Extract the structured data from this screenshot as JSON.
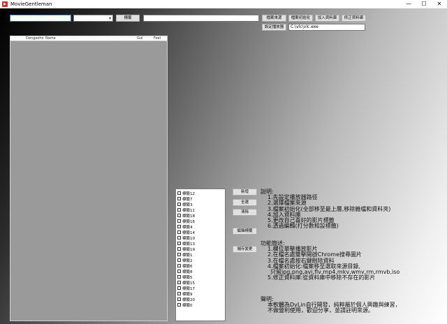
{
  "window": {
    "title": "MovieGentleman",
    "icon": "film-clapper-icon",
    "minimize": "—",
    "maximize": "☐",
    "close": "✕"
  },
  "toolbar": {
    "search_value": "",
    "category_value": "",
    "tag_button": "標籤",
    "source_path_value": "",
    "source_button": "檔案來源",
    "init_button": "檔案初始化",
    "add_db_button": "加入資料庫",
    "edit_db_button": "修正資料庫",
    "set_player_button": "設定播放器",
    "player_path_value": "C:\\vlc\\vlc.exe"
  },
  "listview": {
    "columns": [
      "Dengaoho",
      "Name",
      "Gul",
      "Feel"
    ]
  },
  "tags": [
    "標籤12",
    "標籤7",
    "標籤3",
    "標籤11",
    "標籤18",
    "標籤16",
    "標籤4",
    "標籤14",
    "標籤10",
    "標籤13",
    "標籤19",
    "標籤1",
    "標籤2",
    "標籤6",
    "標籤8",
    "標籤5",
    "標籤15",
    "標籤17",
    "標籤9",
    "標籤20",
    "標籤0"
  ],
  "tag_actions": {
    "new_button": "新增",
    "save_button": "全選",
    "delete_button": "清除",
    "edit_tag_button": "編輯標籤",
    "save_change_button": "儲存變更"
  },
  "help": {
    "intro_title": "說明:",
    "intro_lines": [
      "1.先設定播放器路徑",
      "2.選擇檔案來源",
      "3.檔案初始化(全部移至最上層,移除雜檔和資料夾)",
      "4.加入資料庫",
      "5.更改自己喜好的影片標籤",
      "6.透過編輯(打分數和設標籤)"
    ],
    "features_title": "功能簡述:",
    "feature_lines": [
      "1.欄位單擊播放影片",
      "2.在檔名處雙擊開啟Chrome搜尋圖片",
      "3.在檔名處按右鍵刪除資料",
      "4.檔案初始化:檔案移至選取來源目錄,",
      "只留jpg,png,avi,flv,mp4,mkv,wmv,rm,rmvb,iso",
      "5.修正資料庫:從資料庫中移除不存在的影片"
    ],
    "notice_title": "聲明:",
    "notice_lines": [
      "本軟體為DyLin自行開發，純粹屬於個人興趣與練習，",
      "不做營利使用，歡迎分享，並請註明來源。"
    ]
  }
}
